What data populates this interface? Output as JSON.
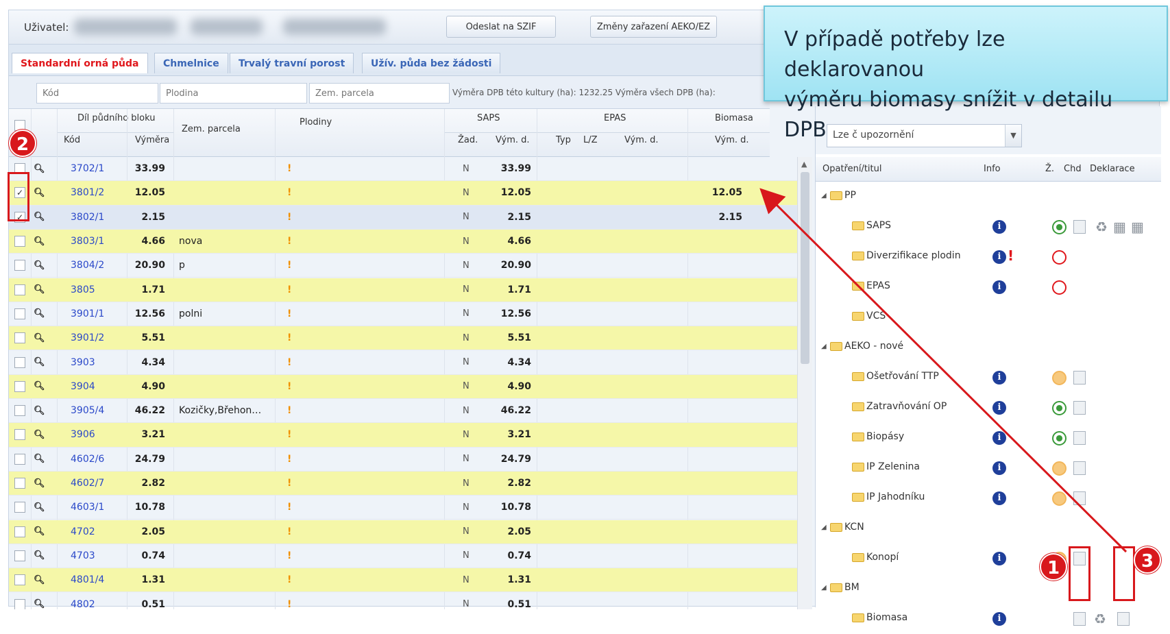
{
  "userbar": {
    "user_label": "Uživatel:",
    "btn_send": "Odeslat na SZIF",
    "btn_changes": "Změny zařazení AEKO/EZ"
  },
  "tabs": [
    {
      "label": "Standardní orná půda",
      "active": true
    },
    {
      "label": "Chmelnice",
      "active": false
    },
    {
      "label": "Trvalý travní porost",
      "active": false
    },
    {
      "label": "Užív. půda bez žádosti",
      "active": false
    }
  ],
  "filters": {
    "kod_placeholder": "Kód",
    "plodina_placeholder": "Plodina",
    "parcela_placeholder": "Zem. parcela",
    "info": "Výměra DPB této kultury (ha): 1232.25   Výměra všech DPB (ha):"
  },
  "grid_header": {
    "dil_bloku": "Díl půdního bloku",
    "kod": "Kód",
    "vymera": "Výměra",
    "zem_parcela": "Zem. parcela",
    "plodiny": "Plodiny",
    "saps": "SAPS",
    "zad": "Žad.",
    "vym_d": "Vým. d.",
    "epas": "EPAS",
    "typ": "Typ",
    "lz": "L/Z",
    "epas_vym_d": "Vým. d.",
    "biomasa": "Biomasa",
    "bio_vym_d": "Vým. d."
  },
  "rows": [
    {
      "checked": false,
      "kod": "3702/1",
      "vymera": "33.99",
      "parcela": "",
      "zad": "N",
      "saps_vym": "33.99",
      "bio": "",
      "style": "normal"
    },
    {
      "checked": true,
      "kod": "3801/2",
      "vymera": "12.05",
      "parcela": "",
      "zad": "N",
      "saps_vym": "12.05",
      "bio": "12.05",
      "style": "alt"
    },
    {
      "checked": true,
      "kod": "3802/1",
      "vymera": "2.15",
      "parcela": "",
      "zad": "N",
      "saps_vym": "2.15",
      "bio": "2.15",
      "style": "sel"
    },
    {
      "checked": false,
      "kod": "3803/1",
      "vymera": "4.66",
      "parcela": "nova",
      "zad": "N",
      "saps_vym": "4.66",
      "bio": "",
      "style": "alt"
    },
    {
      "checked": false,
      "kod": "3804/2",
      "vymera": "20.90",
      "parcela": "p",
      "zad": "N",
      "saps_vym": "20.90",
      "bio": "",
      "style": "normal"
    },
    {
      "checked": false,
      "kod": "3805",
      "vymera": "1.71",
      "parcela": "",
      "zad": "N",
      "saps_vym": "1.71",
      "bio": "",
      "style": "alt"
    },
    {
      "checked": false,
      "kod": "3901/1",
      "vymera": "12.56",
      "parcela": "polni",
      "zad": "N",
      "saps_vym": "12.56",
      "bio": "",
      "style": "normal"
    },
    {
      "checked": false,
      "kod": "3901/2",
      "vymera": "5.51",
      "parcela": "",
      "zad": "N",
      "saps_vym": "5.51",
      "bio": "",
      "style": "alt"
    },
    {
      "checked": false,
      "kod": "3903",
      "vymera": "4.34",
      "parcela": "",
      "zad": "N",
      "saps_vym": "4.34",
      "bio": "",
      "style": "normal"
    },
    {
      "checked": false,
      "kod": "3904",
      "vymera": "4.90",
      "parcela": "",
      "zad": "N",
      "saps_vym": "4.90",
      "bio": "",
      "style": "alt"
    },
    {
      "checked": false,
      "kod": "3905/4",
      "vymera": "46.22",
      "parcela": "Kozičky,Břehon…",
      "zad": "N",
      "saps_vym": "46.22",
      "bio": "",
      "style": "normal"
    },
    {
      "checked": false,
      "kod": "3906",
      "vymera": "3.21",
      "parcela": "",
      "zad": "N",
      "saps_vym": "3.21",
      "bio": "",
      "style": "alt"
    },
    {
      "checked": false,
      "kod": "4602/6",
      "vymera": "24.79",
      "parcela": "",
      "zad": "N",
      "saps_vym": "24.79",
      "bio": "",
      "style": "normal"
    },
    {
      "checked": false,
      "kod": "4602/7",
      "vymera": "2.82",
      "parcela": "",
      "zad": "N",
      "saps_vym": "2.82",
      "bio": "",
      "style": "alt"
    },
    {
      "checked": false,
      "kod": "4603/1",
      "vymera": "10.78",
      "parcela": "",
      "zad": "N",
      "saps_vym": "10.78",
      "bio": "",
      "style": "normal"
    },
    {
      "checked": false,
      "kod": "4702",
      "vymera": "2.05",
      "parcela": "",
      "zad": "N",
      "saps_vym": "2.05",
      "bio": "",
      "style": "alt"
    },
    {
      "checked": false,
      "kod": "4703",
      "vymera": "0.74",
      "parcela": "",
      "zad": "N",
      "saps_vym": "0.74",
      "bio": "",
      "style": "normal"
    },
    {
      "checked": false,
      "kod": "4801/4",
      "vymera": "1.31",
      "parcela": "",
      "zad": "N",
      "saps_vym": "1.31",
      "bio": "",
      "style": "alt"
    },
    {
      "checked": false,
      "kod": "4802",
      "vymera": "0.51",
      "parcela": "",
      "zad": "N",
      "saps_vym": "0.51",
      "bio": "",
      "style": "normal"
    }
  ],
  "plodiny_mark": "!",
  "right_panel": {
    "select_value": "Lze č upozornění",
    "headers": {
      "opatreni": "Opatření/titul",
      "info": "Info",
      "z": "Ž.",
      "chd": "Chd",
      "deklarace": "Deklarace"
    },
    "tree": [
      {
        "label": "PP",
        "indent": 0,
        "group": true
      },
      {
        "label": "SAPS",
        "indent": 1,
        "info": true,
        "status": "green"
      },
      {
        "label": "Diverzifikace plodin",
        "indent": 1,
        "info": true,
        "warn": "!",
        "status": "red"
      },
      {
        "label": "EPAS",
        "indent": 1,
        "info": true,
        "status": "red"
      },
      {
        "label": "VCS",
        "indent": 1
      },
      {
        "label": "AEKO - nové",
        "indent": 0,
        "group": true
      },
      {
        "label": "Ošetřování TTP",
        "indent": 1,
        "info": true,
        "status": "orange"
      },
      {
        "label": "Zatravňování OP",
        "indent": 1,
        "info": true,
        "status": "green"
      },
      {
        "label": "Biopásy",
        "indent": 1,
        "info": true,
        "status": "green"
      },
      {
        "label": "IP Zelenina",
        "indent": 1,
        "info": true,
        "status": "orange"
      },
      {
        "label": "IP Jahodníku",
        "indent": 1,
        "info": true,
        "status": "orange"
      },
      {
        "label": "KCN",
        "indent": 0,
        "group": true
      },
      {
        "label": "Konopí",
        "indent": 1,
        "info": true,
        "status": "orange"
      },
      {
        "label": "BM",
        "indent": 0,
        "group": true
      },
      {
        "label": "Biomasa",
        "indent": 1,
        "info": true
      }
    ],
    "info_letter": "i"
  },
  "callout": {
    "line1": "V případě potřeby lze deklarovanou",
    "line2": "výměru biomasy snížit v detailu DPB"
  },
  "markers": {
    "m1": "1",
    "m2": "2",
    "m3": "3"
  },
  "colors": {
    "accent_red": "#d8181c",
    "row_alt": "#f5f7a8",
    "link_blue": "#2a48c9",
    "active_tab": "#e0171c"
  }
}
